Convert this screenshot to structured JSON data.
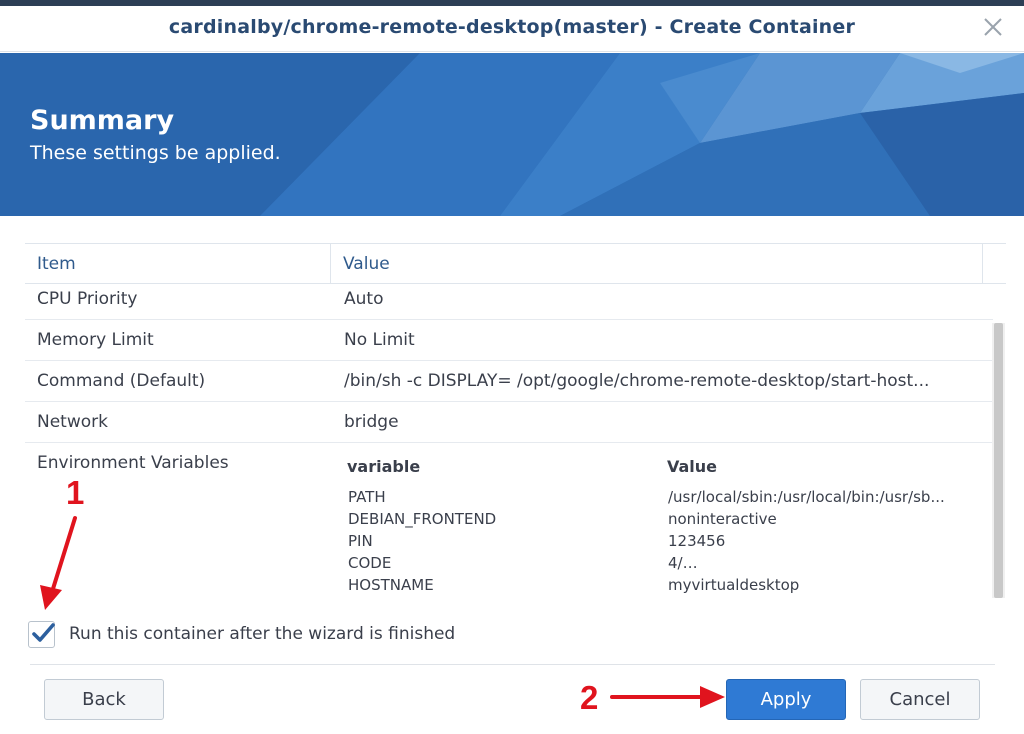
{
  "window": {
    "title": "cardinalby/chrome-remote-desktop(master) - Create Container",
    "close_icon": "close-icon"
  },
  "banner": {
    "title": "Summary",
    "subtitle": "These settings be applied."
  },
  "table": {
    "headers": {
      "item": "Item",
      "value": "Value"
    },
    "rows": [
      {
        "item": "CPU Priority",
        "value": "Auto"
      },
      {
        "item": "Memory Limit",
        "value": "No Limit"
      },
      {
        "item": "Command (Default)",
        "value": "/bin/sh -c DISPLAY= /opt/google/chrome-remote-desktop/start-host..."
      },
      {
        "item": "Network",
        "value": "bridge"
      }
    ],
    "env": {
      "label": "Environment Variables",
      "headers": {
        "variable": "variable",
        "value": "Value"
      },
      "vars": [
        {
          "name": "PATH",
          "value": "/usr/local/sbin:/usr/local/bin:/usr/sb..."
        },
        {
          "name": "DEBIAN_FRONTEND",
          "value": "noninteractive"
        },
        {
          "name": "PIN",
          "value": "123456"
        },
        {
          "name": "CODE",
          "value_prefix": "4/",
          "value_blurred": "xxxxxxxxxxxxxxxxxxxxxxxxxxxxxxxxxx"
        },
        {
          "name": "HOSTNAME",
          "value": "myvirtualdesktop"
        }
      ]
    }
  },
  "options": {
    "run_after_wizard": {
      "label": "Run this container after the wizard is finished",
      "checked": true
    }
  },
  "buttons": {
    "back": "Back",
    "apply": "Apply",
    "cancel": "Cancel"
  },
  "annotations": {
    "marker_1": "1",
    "marker_2": "2"
  },
  "colors": {
    "title_text": "#2a4a72",
    "banner_blue": "#2e6db5",
    "primary_button": "#2f7ad4",
    "annotation_red": "#e0141e"
  }
}
